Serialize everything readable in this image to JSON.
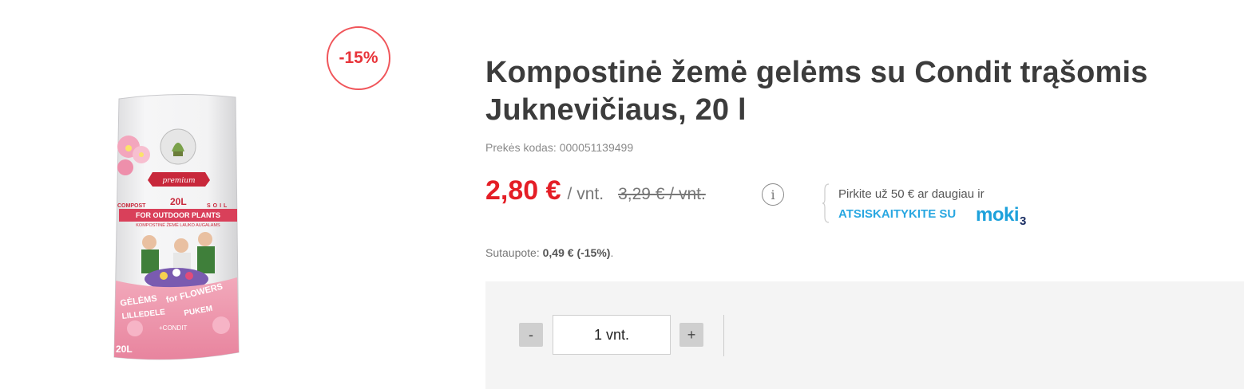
{
  "product": {
    "title": "Kompostinė žemė gelėms su Condit trąšomis Juknevičiaus, 20 l",
    "image_alt": "Kompostinė žemė gelėms su Condit trąšomis Juknevičiaus, 20 l",
    "discount_badge": "-15%",
    "sku_label": "Prekės kodas:",
    "sku_value": "000051139499"
  },
  "packaging_text": {
    "premium": "premium",
    "compost": "COMPOST",
    "volume": "20L",
    "soil": "SOIL",
    "outdoor": "FOR OUTDOOR PLANTS",
    "outdoor_lt": "KOMPOSTINĖ ŽEMĖ LAUKO AUGALAMS",
    "gelems": "GĖLĖMS",
    "for_flowers": "for FLOWERS",
    "lilledele": "LILLEDELE",
    "pukem": "PUKEM",
    "condit": "+CONDIT",
    "side_volume": "20L"
  },
  "price": {
    "current": "2,80 €",
    "unit": "/ vnt.",
    "old": "3,29 € / vnt."
  },
  "financing": {
    "text": "Pirkite už 50 € ar daugiau ir",
    "link": "ATSISKAITYKITE SU",
    "logo_main": "moki",
    "logo_suffix": "3"
  },
  "savings": {
    "label": "Sutaupote:",
    "value": "0,49 € (-15%)",
    "suffix": "."
  },
  "cart": {
    "minus_label": "-",
    "plus_label": "+",
    "quantity_value": "1 vnt."
  },
  "colors": {
    "accent_red": "#e41e26",
    "badge_border": "#f0555a",
    "link_blue": "#29a7e1",
    "buy_box_bg": "#f4f4f4"
  },
  "icons": {
    "info": "info-icon",
    "brace": "brace-icon"
  }
}
